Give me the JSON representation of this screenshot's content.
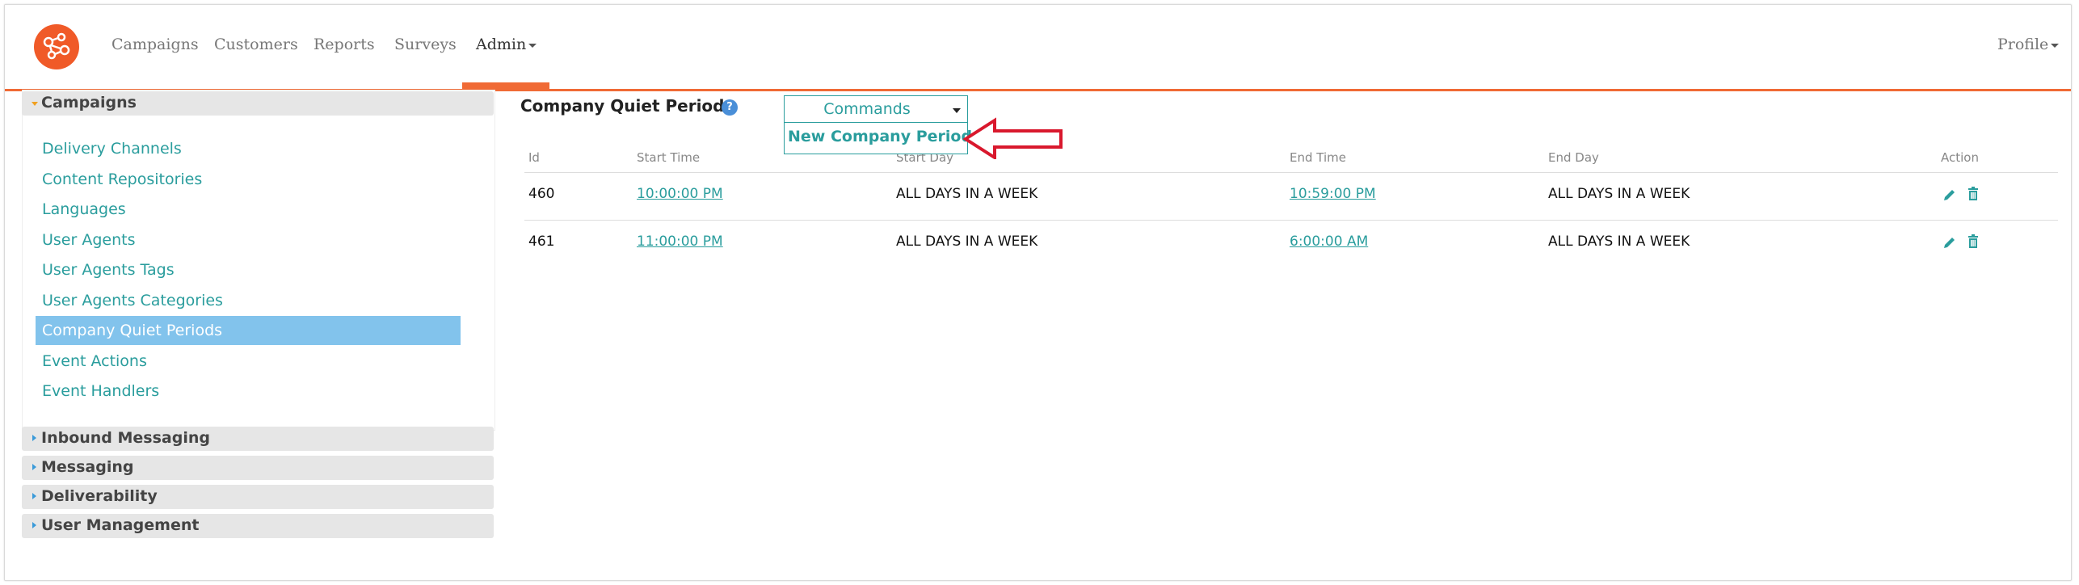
{
  "nav": {
    "items": [
      "Campaigns",
      "Customers",
      "Reports",
      "Surveys",
      "Admin"
    ],
    "profile": "Profile"
  },
  "sidebar": {
    "campaigns_header": "Campaigns",
    "items": [
      "Delivery Channels",
      "Content Repositories",
      "Languages",
      "User Agents",
      "User Agents Tags",
      "User Agents Categories",
      "Company Quiet Periods",
      "Event Actions",
      "Event Handlers"
    ],
    "active_item": "Company Quiet Periods",
    "sections": [
      "Inbound Messaging",
      "Messaging",
      "Deliverability",
      "User Management"
    ]
  },
  "main": {
    "title": "Company Quiet Periods",
    "help_glyph": "?",
    "commands_label": "Commands",
    "dropdown_item": "New Company Period"
  },
  "table": {
    "headers": [
      "Id",
      "Start Time",
      "Start Day",
      "End Time",
      "End Day",
      "Action"
    ],
    "rows": [
      {
        "id": "460",
        "start_time": "10:00:00 PM",
        "start_day": "ALL DAYS IN A WEEK",
        "end_time": "10:59:00 PM",
        "end_day": "ALL DAYS IN A WEEK"
      },
      {
        "id": "461",
        "start_time": "11:00:00 PM",
        "start_day": "ALL DAYS IN A WEEK",
        "end_time": "6:00:00 AM",
        "end_day": "ALL DAYS IN A WEEK"
      }
    ]
  },
  "colors": {
    "accent": "#f06a35",
    "link": "#2a9d9d",
    "active_bg": "#82c3ec",
    "annotation_arrow": "#d9182d"
  }
}
